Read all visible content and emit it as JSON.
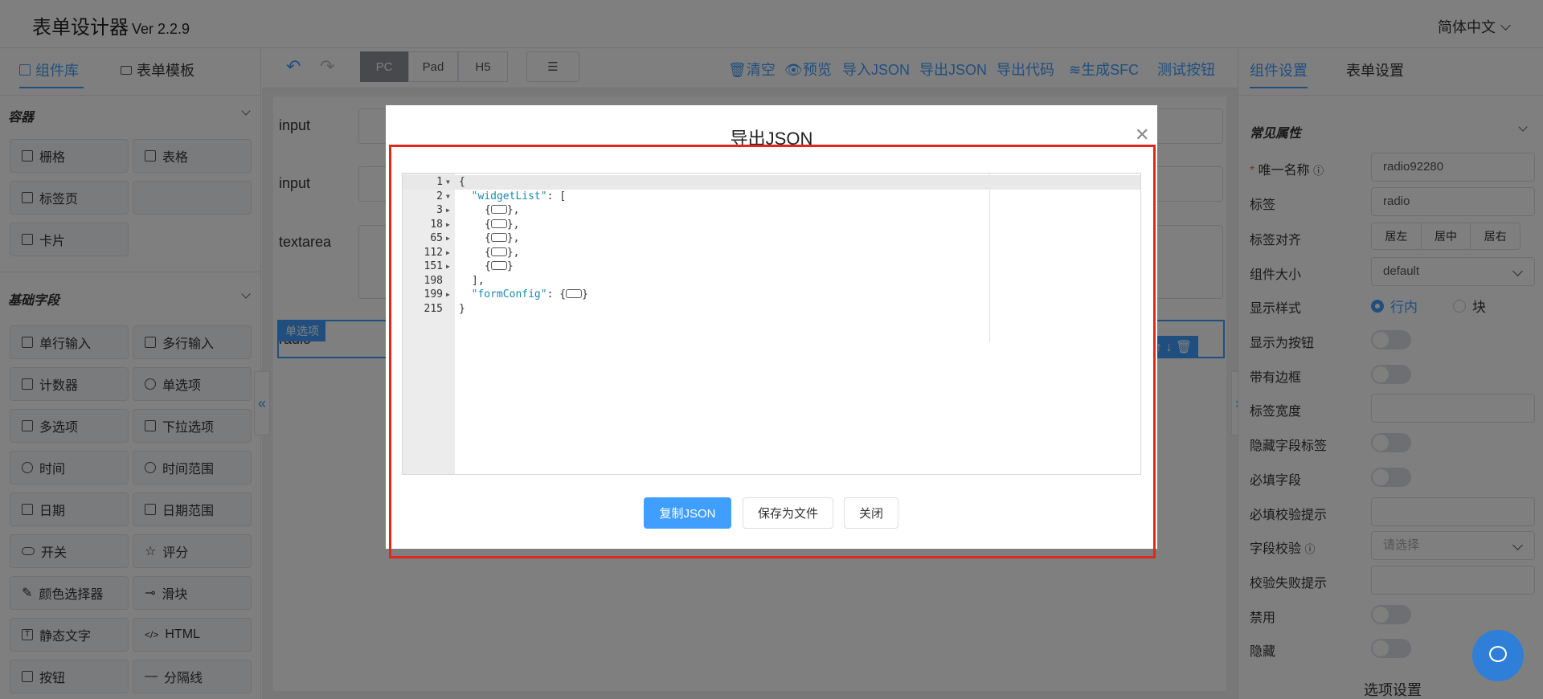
{
  "app": {
    "title": "表单设计器",
    "version": "Ver 2.2.9",
    "language": "简体中文"
  },
  "left_panel": {
    "tabs": [
      {
        "label": "组件库",
        "active": true
      },
      {
        "label": "表单模板",
        "active": false
      }
    ],
    "sections": [
      {
        "title": "容器",
        "items": [
          "栅格",
          "表格",
          "标签页",
          "",
          "卡片"
        ]
      },
      {
        "title": "基础字段",
        "items": [
          "单行输入",
          "多行输入",
          "计数器",
          "单选项",
          "多选项",
          "下拉选项",
          "时间",
          "时间范围",
          "日期",
          "日期范围",
          "开关",
          "评分",
          "颜色选择器",
          "滑块",
          "静态文字",
          "HTML",
          "按钮",
          "分隔线"
        ]
      }
    ]
  },
  "toolbar": {
    "devices": [
      "PC",
      "Pad",
      "H5"
    ],
    "active_device": "PC",
    "actions": [
      "清空",
      "预览",
      "导入JSON",
      "导出JSON",
      "导出代码",
      "生成SFC",
      "测试按钮"
    ]
  },
  "canvas": {
    "fields": [
      {
        "label": "input"
      },
      {
        "label": "input"
      },
      {
        "label": "textarea"
      },
      {
        "label": "radio",
        "tag": "单选项",
        "selected": true
      }
    ]
  },
  "right_panel": {
    "tabs": [
      {
        "label": "组件设置",
        "active": true
      },
      {
        "label": "表单设置",
        "active": false
      }
    ],
    "section_title": "常见属性",
    "props": {
      "name_label": "唯一名称",
      "name_value": "radio92280",
      "label_label": "标签",
      "label_value": "radio",
      "align_label": "标签对齐",
      "align_options": [
        "居左",
        "居中",
        "居右"
      ],
      "size_label": "组件大小",
      "size_value": "default",
      "display_label": "显示样式",
      "display_options": [
        "行内",
        "块"
      ],
      "display_selected": "行内",
      "as_button_label": "显示为按钮",
      "border_label": "带有边框",
      "label_width_label": "标签宽度",
      "hide_label_label": "隐藏字段标签",
      "required_label": "必填字段",
      "required_hint_label": "必填校验提示",
      "validation_label": "字段校验",
      "validation_placeholder": "请选择",
      "validation_fail_label": "校验失败提示",
      "disabled_label": "禁用",
      "hidden_label": "隐藏"
    },
    "options_title": "选项设置"
  },
  "dialog": {
    "title": "导出JSON",
    "code_lines": [
      {
        "ln": "1",
        "fold": "open",
        "text": "{"
      },
      {
        "ln": "2",
        "fold": "open",
        "key": "\"widgetList\"",
        "text": ": ["
      },
      {
        "ln": "3",
        "fold": "closed",
        "indent": 4,
        "collapsed": true,
        "text": ","
      },
      {
        "ln": "18",
        "fold": "closed",
        "indent": 4,
        "collapsed": true,
        "text": ","
      },
      {
        "ln": "65",
        "fold": "closed",
        "indent": 4,
        "collapsed": true,
        "text": ","
      },
      {
        "ln": "112",
        "fold": "closed",
        "indent": 4,
        "collapsed": true,
        "text": ","
      },
      {
        "ln": "151",
        "fold": "closed",
        "indent": 4,
        "collapsed": true,
        "text": ""
      },
      {
        "ln": "198",
        "fold": "",
        "indent": 2,
        "text": "],"
      },
      {
        "ln": "199",
        "fold": "closed",
        "key": "\"formConfig\"",
        "text": ": ",
        "collapsed": true
      },
      {
        "ln": "215",
        "fold": "",
        "text": "}"
      }
    ],
    "buttons": {
      "copy": "复制JSON",
      "save": "保存为文件",
      "close": "关闭"
    }
  },
  "colors": {
    "primary": "#409eff",
    "highlight_border": "#e0261e",
    "fab": "#2f7fd8"
  }
}
